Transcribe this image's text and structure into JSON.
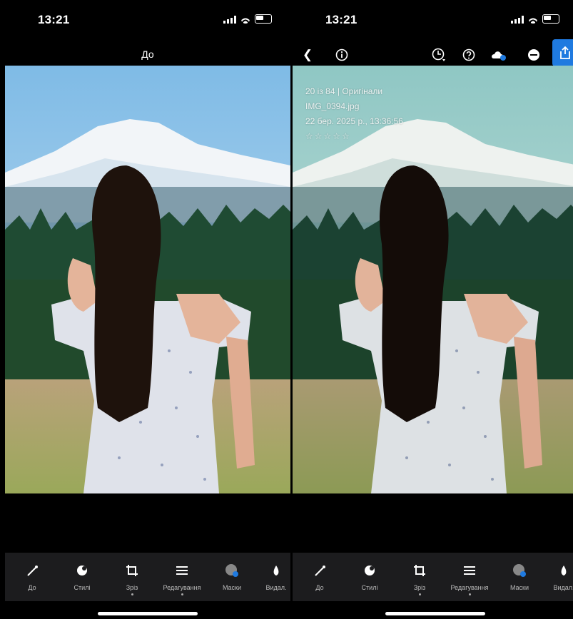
{
  "status": {
    "time": "13:21"
  },
  "before_panel": {
    "title": "До"
  },
  "after_panel": {
    "overlay": {
      "line1": "20 із 84 | Оригінали",
      "line2": "IMG_0394.jpg",
      "line3": "22 бер. 2025 р., 13:36:56",
      "stars": "☆☆☆☆☆"
    }
  },
  "toolbar": {
    "items": [
      {
        "label": "До",
        "icon": "magic-wand-icon"
      },
      {
        "label": "Стилі",
        "icon": "styles-icon"
      },
      {
        "label": "Зріз",
        "icon": "crop-icon"
      },
      {
        "label": "Редагування",
        "icon": "sliders-icon"
      },
      {
        "label": "Маски",
        "icon": "masks-icon"
      },
      {
        "label": "Видал.",
        "icon": "eraser-icon"
      }
    ]
  },
  "colors": {
    "accent": "#1f7ae0",
    "toolbar_bg": "#1c1c1e"
  }
}
